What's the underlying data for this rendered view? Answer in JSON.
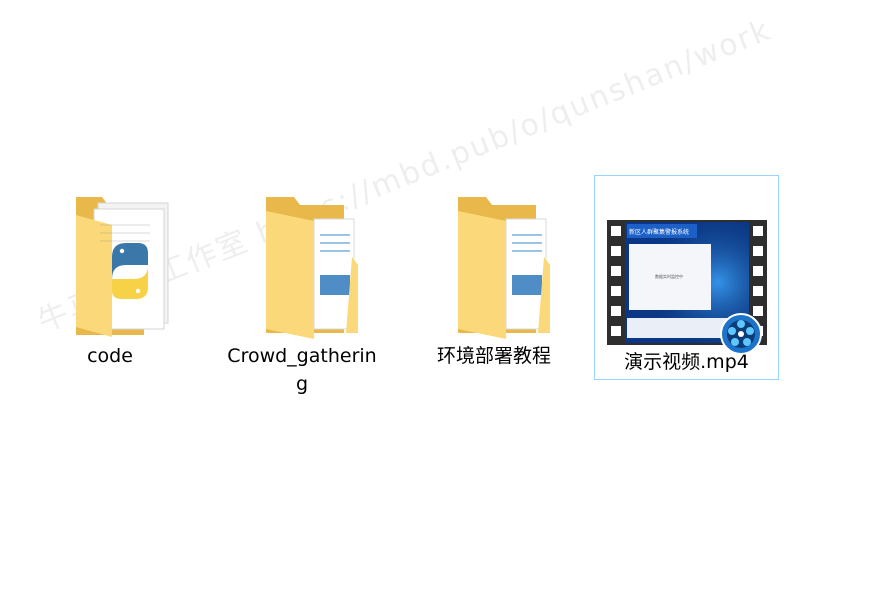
{
  "watermark": "牛马视觉工作室   https://mbd.pub/o/qunshan/work",
  "files": [
    {
      "name": "code",
      "type": "folder",
      "icon": "python-folder-icon"
    },
    {
      "name": "Crowd_gathering",
      "type": "folder",
      "icon": "document-folder-icon"
    },
    {
      "name": "环境部署教程",
      "type": "folder",
      "icon": "document-folder-icon"
    },
    {
      "name": "演示视频.mp4",
      "type": "video",
      "icon": "video-thumbnail-icon",
      "selected": true,
      "thumbnail": {
        "title": "新区人群聚集警报系统",
        "body": "数据实时监控中"
      }
    }
  ],
  "colors": {
    "folder_back": "#e8b84a",
    "folder_front": "#fbd97a",
    "selection_border": "#99d1ff",
    "python_blue": "#3b77a8",
    "python_yellow": "#f7d246"
  }
}
